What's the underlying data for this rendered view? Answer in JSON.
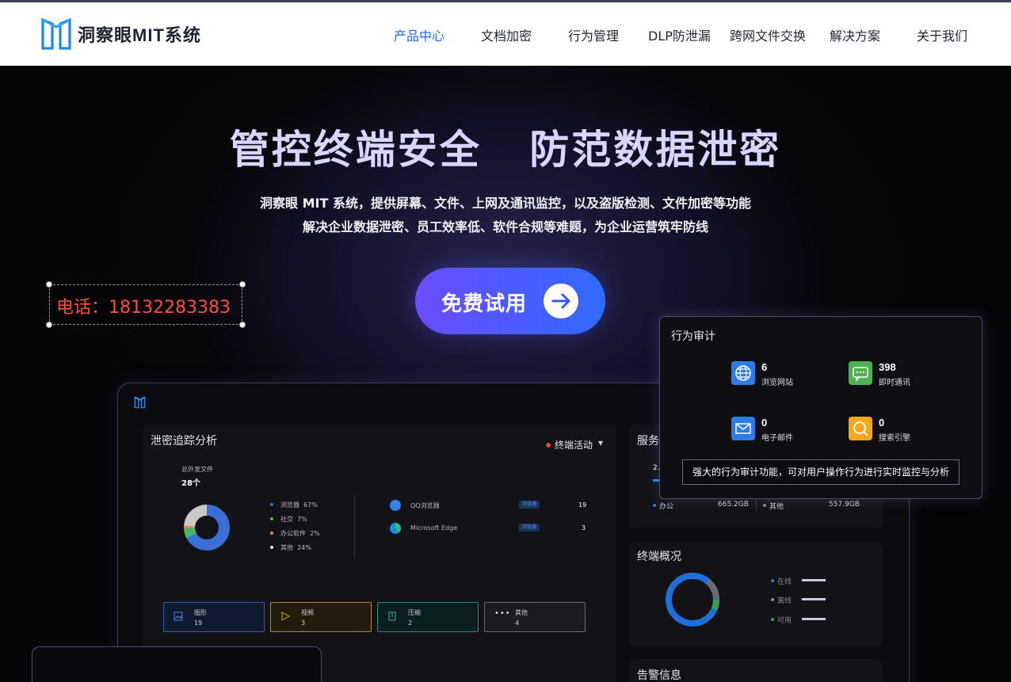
{
  "brand": {
    "name": "洞察眼MIT系统"
  },
  "nav": {
    "items": [
      {
        "label": "产品中心",
        "active": true
      },
      {
        "label": "文档加密"
      },
      {
        "label": "行为管理"
      },
      {
        "label": "DLP防泄漏"
      },
      {
        "label": "跨网文件交换"
      },
      {
        "label": "解决方案"
      },
      {
        "label": "关于我们"
      }
    ]
  },
  "hero": {
    "headline": "管控终端安全 防范数据泄密",
    "line1": "洞察眼 MIT 系统，提供屏幕、文件、上网及通讯监控，以及盗版检测、文件加密等功能",
    "line2": "解决企业数据泄密、员工效率低、软件合规等难题，为企业运营筑牢防线",
    "cta": "免费试用"
  },
  "contact": {
    "phone": "电话：18132283383"
  },
  "dashboard": {
    "leak": {
      "title": "泄密追踪分析",
      "filter": "终端活动",
      "total_label": "总外发文件",
      "total_value": "28个",
      "legend": [
        {
          "label": "浏览器",
          "pct": "67%",
          "value": 67,
          "color": "#3a6fd8"
        },
        {
          "label": "社交",
          "pct": "7%",
          "value": 7,
          "color": "#45b36b"
        },
        {
          "label": "办公软件",
          "pct": "2%",
          "value": 2,
          "color": "#e08a3a"
        },
        {
          "label": "其他",
          "pct": "24%",
          "value": 24,
          "color": "#c9c9c9"
        }
      ],
      "apps": [
        {
          "name": "QQ浏览器",
          "tag": "浏览器",
          "count": "19"
        },
        {
          "name": "Microsoft Edge",
          "tag": "浏览器",
          "count": "3"
        }
      ],
      "cards": [
        {
          "label": "图形",
          "value": "19",
          "color": "#2a5cb8"
        },
        {
          "label": "视频",
          "value": "3",
          "color": "#b08a30"
        },
        {
          "label": "压缩",
          "value": "2",
          "color": "#2a8a86"
        },
        {
          "label": "其他",
          "value": "4",
          "color": "#6a6a70"
        }
      ]
    },
    "server": {
      "title": "服务",
      "amount": "2.",
      "items": [
        {
          "label": "办公",
          "value": "665.2GB"
        },
        {
          "label": "其他",
          "value": "557.9GB"
        }
      ]
    },
    "endpoint": {
      "title": "终端概况",
      "legend": [
        {
          "label": "在线"
        },
        {
          "label": "离线"
        },
        {
          "label": "可用"
        }
      ]
    },
    "alerts": {
      "title": "告警信息"
    }
  },
  "audit": {
    "title": "行为审计",
    "items": [
      {
        "num": "6",
        "label": "浏览网站",
        "color": "#2d7be8",
        "icon": "globe-icon"
      },
      {
        "num": "398",
        "label": "即时通讯",
        "color": "#4fb24f",
        "icon": "chat-icon"
      },
      {
        "num": "0",
        "label": "电子邮件",
        "color": "#2d7be8",
        "icon": "mail-icon"
      },
      {
        "num": "0",
        "label": "搜索引擎",
        "color": "#f2a81b",
        "icon": "search-icon"
      }
    ],
    "tooltip": "强大的行为审计功能，可对用户操作行为进行实时监控与分析"
  }
}
